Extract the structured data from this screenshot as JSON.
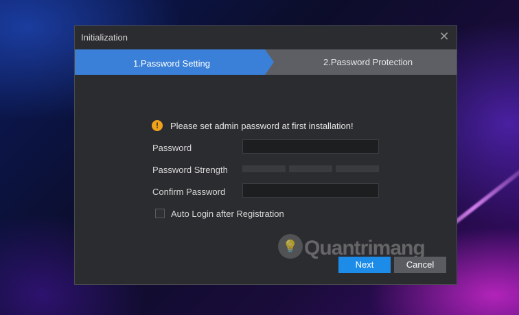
{
  "window": {
    "title": "Initialization",
    "close_icon": "close-icon"
  },
  "steps": [
    {
      "label": "1.Password Setting",
      "active": true
    },
    {
      "label": "2.Password Protection",
      "active": false
    }
  ],
  "form": {
    "message": "Please set admin password at first installation!",
    "message_icon": "warning-icon",
    "password_label": "Password",
    "password_value": "",
    "strength_label": "Password Strength",
    "strength_level": 0,
    "confirm_label": "Confirm Password",
    "confirm_value": "",
    "auto_login_label": "Auto Login after Registration",
    "auto_login_checked": false
  },
  "buttons": {
    "next": "Next",
    "cancel": "Cancel"
  },
  "watermark": {
    "text": "Quantrimang"
  },
  "colors": {
    "accent": "#1c8ce8",
    "step_active": "#3a80d8",
    "warning": "#f0a21b"
  }
}
